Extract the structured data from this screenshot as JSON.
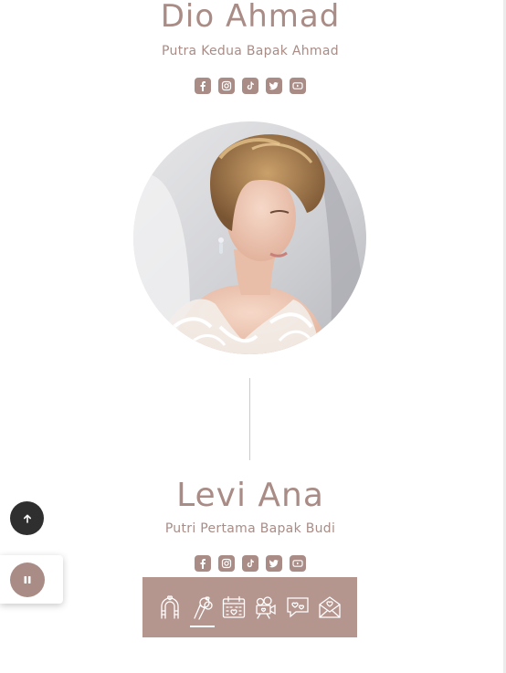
{
  "colors": {
    "accent": "#a98c86",
    "nav_background": "#b5968f",
    "scroll_top_background": "#2f2f2f",
    "divider": "#d9c5c1"
  },
  "groom": {
    "name": "Dio Ahmad",
    "subtitle": "Putra Kedua Bapak Ahmad",
    "socials": [
      "facebook-icon",
      "instagram-icon",
      "tiktok-icon",
      "twitter-icon",
      "youtube-icon"
    ]
  },
  "bride": {
    "name": "Levi Ana",
    "subtitle": "Putri Pertama Bapak Budi",
    "socials": [
      "facebook-icon",
      "instagram-icon",
      "tiktok-icon",
      "twitter-icon",
      "youtube-icon"
    ]
  },
  "controls": {
    "scroll_top_icon": "arrow-up-icon",
    "music_icon": "pause-icon"
  },
  "bottom_nav": {
    "items": [
      {
        "icon": "wedding-arch-icon",
        "active": false
      },
      {
        "icon": "couple-rings-icon",
        "active": true
      },
      {
        "icon": "calendar-heart-icon",
        "active": false
      },
      {
        "icon": "video-camera-icon",
        "active": false
      },
      {
        "icon": "chat-hearts-icon",
        "active": false
      },
      {
        "icon": "love-letter-icon",
        "active": false
      }
    ]
  }
}
